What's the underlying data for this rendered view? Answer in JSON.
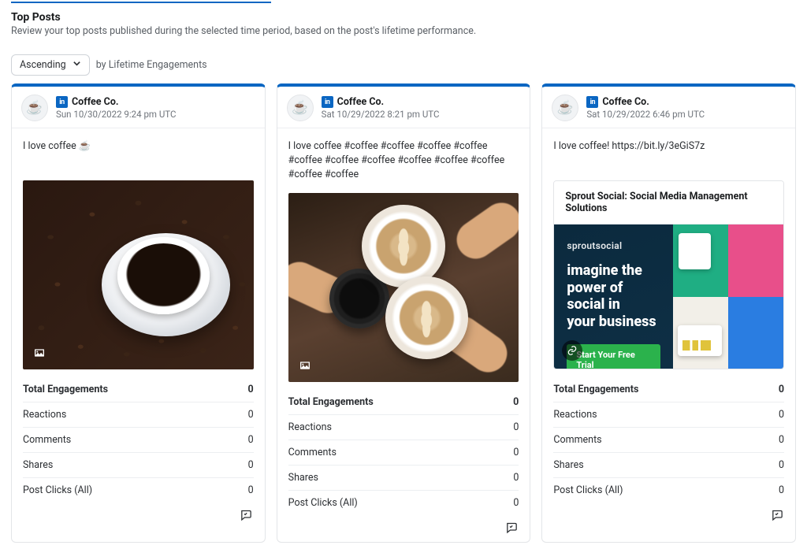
{
  "section": {
    "title": "Top Posts",
    "subtitle": "Review your top posts published during the selected time period, based on the post's lifetime performance."
  },
  "sort": {
    "dropdown_label": "Ascending",
    "prefix": "by",
    "metric": "Lifetime Engagements"
  },
  "network_badge": "in",
  "metrics_labels": {
    "total_engagements": "Total Engagements",
    "reactions": "Reactions",
    "comments": "Comments",
    "shares": "Shares",
    "post_clicks": "Post Clicks (All)"
  },
  "posts": [
    {
      "author": "Coffee Co.",
      "timestamp": "Sun 10/30/2022 9:24 pm UTC",
      "text": "I love coffee ☕",
      "media_kind": "image",
      "metrics": {
        "total_engagements": "0",
        "reactions": "0",
        "comments": "0",
        "shares": "0",
        "post_clicks": "0"
      }
    },
    {
      "author": "Coffee Co.",
      "timestamp": "Sat 10/29/2022 8:21 pm UTC",
      "text": "I love coffee #coffee #coffee #coffee #coffee #coffee #coffee #coffee #coffee #coffee #coffee #coffee #coffee",
      "media_kind": "image",
      "metrics": {
        "total_engagements": "0",
        "reactions": "0",
        "comments": "0",
        "shares": "0",
        "post_clicks": "0"
      }
    },
    {
      "author": "Coffee Co.",
      "timestamp": "Sat 10/29/2022 6:46 pm UTC",
      "text": "I love coffee! https://bit.ly/3eGiS7z",
      "media_kind": "link",
      "link_preview": {
        "title": "Sprout Social: Social Media Management Solutions",
        "brand": "sproutsocial",
        "headline_line1": "imagine the",
        "headline_line2": "power of social in",
        "headline_line3": "your business",
        "cta": "Start Your Free Trial"
      },
      "metrics": {
        "total_engagements": "0",
        "reactions": "0",
        "comments": "0",
        "shares": "0",
        "post_clicks": "0"
      }
    }
  ]
}
